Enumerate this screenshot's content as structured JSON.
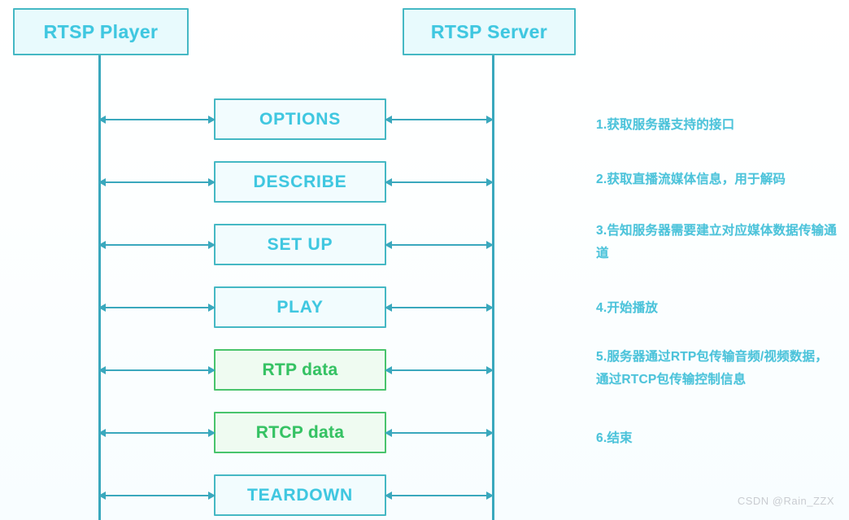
{
  "diagram": {
    "title": "RTSP Player / RTSP Server interaction sequence",
    "colors": {
      "cyan_border": "#45b8c4",
      "cyan_text": "#3fc7e0",
      "cyan_fill": "#f2fcfe",
      "green_border": "#49c46c",
      "green_text": "#35c263",
      "green_fill": "#effbf1",
      "arrow": "#3aa8bd",
      "note_text": "#4cc3da",
      "background": "#ffffff"
    },
    "actors": {
      "left": "RTSP Player",
      "right": "RTSP Server"
    },
    "messages": [
      {
        "label": "OPTIONS",
        "kind": "control"
      },
      {
        "label": "DESCRIBE",
        "kind": "control"
      },
      {
        "label": "SET UP",
        "kind": "control"
      },
      {
        "label": "PLAY",
        "kind": "control"
      },
      {
        "label": "RTP data",
        "kind": "data"
      },
      {
        "label": "RTCP data",
        "kind": "data"
      },
      {
        "label": "TEARDOWN",
        "kind": "control"
      }
    ],
    "notes": [
      {
        "index": "1",
        "text": "1.获取服务器支持的接口"
      },
      {
        "index": "2",
        "text": "2.获取直播流媒体信息，用于解码"
      },
      {
        "index": "3",
        "text": "3.告知服务器需要建立对应媒体数据传输通道"
      },
      {
        "index": "4",
        "text": "4.开始播放"
      },
      {
        "index": "5",
        "text": "5.服务器通过RTP包传输音频/视频数据，通过RTCP包传输控制信息"
      },
      {
        "index": "6",
        "text": "6.结束"
      }
    ],
    "watermark": "CSDN @Rain_ZZX"
  }
}
